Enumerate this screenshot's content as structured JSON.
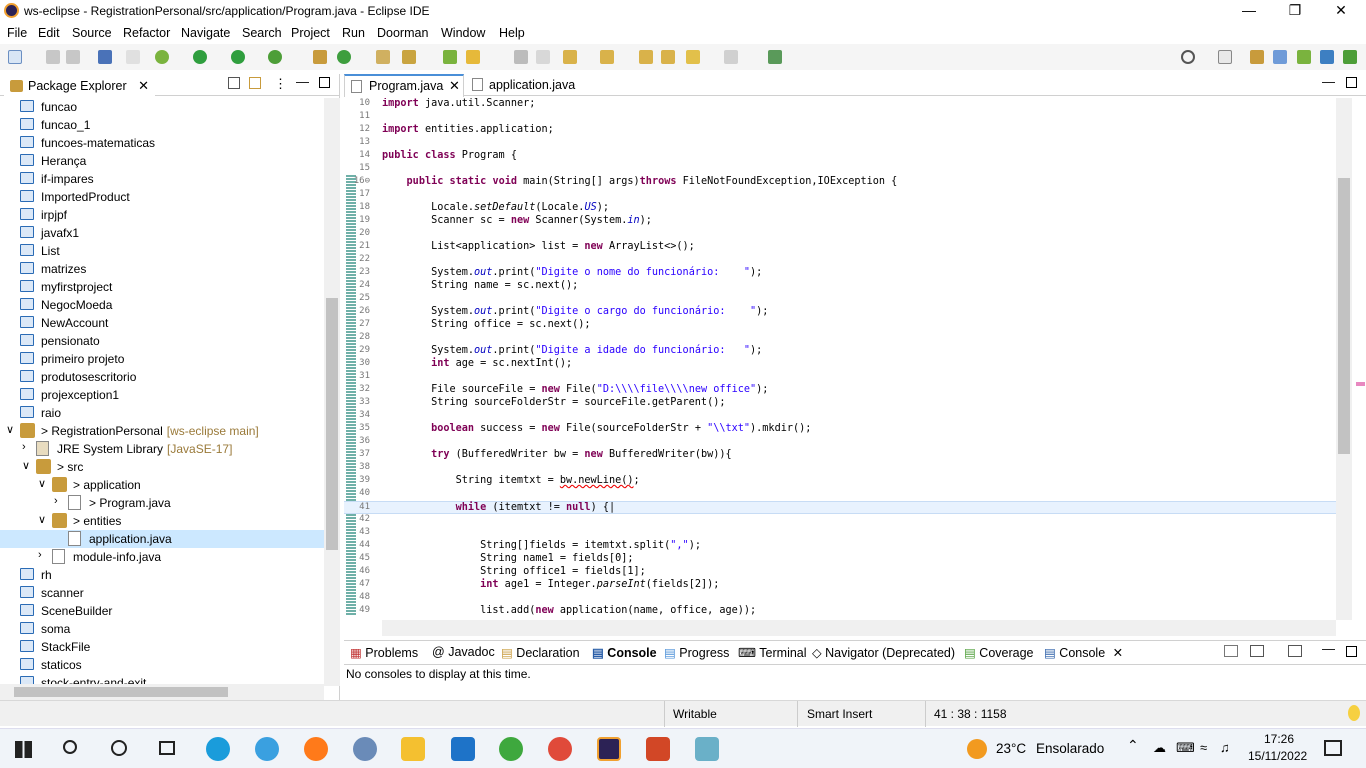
{
  "window": {
    "title": "ws-eclipse - RegistrationPersonal/src/application/Program.java - Eclipse IDE"
  },
  "menu": [
    "File",
    "Edit",
    "Source",
    "Refactor",
    "Navigate",
    "Search",
    "Project",
    "Run",
    "Doorman",
    "Window",
    "Help"
  ],
  "package_explorer": {
    "title": "Package Explorer",
    "items": [
      {
        "label": "funcao",
        "type": "folder",
        "depth": 0
      },
      {
        "label": "funcao_1",
        "type": "folder",
        "depth": 0
      },
      {
        "label": "funcoes-matematicas",
        "type": "folder",
        "depth": 0
      },
      {
        "label": "Herança",
        "type": "folder",
        "depth": 0
      },
      {
        "label": "if-impares",
        "type": "folder",
        "depth": 0
      },
      {
        "label": "ImportedProduct",
        "type": "folder",
        "depth": 0
      },
      {
        "label": "irpjpf",
        "type": "folder",
        "depth": 0
      },
      {
        "label": "javafx1",
        "type": "folder",
        "depth": 0
      },
      {
        "label": "List",
        "type": "folder",
        "depth": 0
      },
      {
        "label": "matrizes",
        "type": "folder",
        "depth": 0
      },
      {
        "label": "myfirstproject",
        "type": "folder",
        "depth": 0
      },
      {
        "label": "NegocMoeda",
        "type": "folder",
        "depth": 0
      },
      {
        "label": "NewAccount",
        "type": "folder",
        "depth": 0
      },
      {
        "label": "pensionato",
        "type": "folder",
        "depth": 0
      },
      {
        "label": "primeiro projeto",
        "type": "folder",
        "depth": 0
      },
      {
        "label": "produtosescritorio",
        "type": "folder",
        "depth": 0
      },
      {
        "label": "projexception1",
        "type": "folder",
        "depth": 0
      },
      {
        "label": "raio",
        "type": "folder",
        "depth": 0
      },
      {
        "label": "> RegistrationPersonal",
        "suffix": "[ws-eclipse main]",
        "type": "project",
        "depth": 0,
        "arrow": "v"
      },
      {
        "label": "JRE System Library",
        "suffix": "[JavaSE-17]",
        "type": "lib",
        "depth": 1,
        "arrow": ">"
      },
      {
        "label": "> src",
        "type": "pkgroot",
        "depth": 1,
        "arrow": "v"
      },
      {
        "label": "> application",
        "type": "pkg",
        "depth": 2,
        "arrow": "v"
      },
      {
        "label": "> Program.java",
        "type": "java",
        "depth": 3,
        "arrow": ">"
      },
      {
        "label": "> entities",
        "type": "pkg",
        "depth": 2,
        "arrow": "v"
      },
      {
        "label": "application.java",
        "type": "java",
        "depth": 3,
        "selected": true
      },
      {
        "label": "module-info.java",
        "type": "java",
        "depth": 2,
        "arrow": ">"
      },
      {
        "label": "rh",
        "type": "folder",
        "depth": 0
      },
      {
        "label": "scanner",
        "type": "folder",
        "depth": 0
      },
      {
        "label": "SceneBuilder",
        "type": "folder",
        "depth": 0
      },
      {
        "label": "soma",
        "type": "folder",
        "depth": 0
      },
      {
        "label": "StackFile",
        "type": "folder",
        "depth": 0
      },
      {
        "label": "staticos",
        "type": "folder",
        "depth": 0
      },
      {
        "label": "stock-entry-and-exit",
        "type": "folder",
        "depth": 0
      }
    ]
  },
  "editor_tabs": [
    {
      "label": "Program.java",
      "active": true
    },
    {
      "label": "application.java",
      "active": false
    }
  ],
  "code_lines": [
    {
      "n": "10",
      "html": "<span class=\"kw\">import</span> java.util.Scanner;"
    },
    {
      "n": "11",
      "html": ""
    },
    {
      "n": "12",
      "html": "<span class=\"kw\">import</span> entities.application;"
    },
    {
      "n": "13",
      "html": ""
    },
    {
      "n": "14",
      "html": "<span class=\"kw\">public</span> <span class=\"kw\">class</span> Program {"
    },
    {
      "n": "15",
      "html": ""
    },
    {
      "n": "16⊖",
      "html": "    <span class=\"kw\">public</span> <span class=\"kw\">static</span> <span class=\"kw\">void</span> main(String[] args)<span class=\"kw\">throws</span> FileNotFoundException,IOException {"
    },
    {
      "n": "17",
      "html": ""
    },
    {
      "n": "18",
      "html": "        Locale.<i>setDefault</i>(Locale.<span class=\"fd\">US</span>);"
    },
    {
      "n": "19",
      "html": "        Scanner sc = <span class=\"kw\">new</span> Scanner(System.<span class=\"fd\">in</span>);"
    },
    {
      "n": "20",
      "html": ""
    },
    {
      "n": "21",
      "html": "        List&lt;application&gt; list = <span class=\"kw\">new</span> ArrayList&lt;&gt;();"
    },
    {
      "n": "22",
      "html": ""
    },
    {
      "n": "23",
      "html": "        System.<span class=\"fd\">out</span>.print(<span class=\"st\">\"Digite o nome do funcionário:    \"</span>);"
    },
    {
      "n": "24",
      "html": "        String name = sc.next();"
    },
    {
      "n": "25",
      "html": ""
    },
    {
      "n": "26",
      "html": "        System.<span class=\"fd\">out</span>.print(<span class=\"st\">\"Digite o cargo do funcionário:    \"</span>);"
    },
    {
      "n": "27",
      "html": "        String office = sc.next();"
    },
    {
      "n": "28",
      "html": ""
    },
    {
      "n": "29",
      "html": "        System.<span class=\"fd\">out</span>.print(<span class=\"st\">\"Digite a idade do funcionário:   \"</span>);"
    },
    {
      "n": "30",
      "html": "        <span class=\"kw\">int</span> age = sc.nextInt();"
    },
    {
      "n": "31",
      "html": ""
    },
    {
      "n": "32",
      "html": "        File sourceFile = <span class=\"kw\">new</span> File(<span class=\"st\">\"D:\\\\\\\\file\\\\\\\\new office\"</span>);"
    },
    {
      "n": "33",
      "html": "        String sourceFolderStr = sourceFile.getParent();"
    },
    {
      "n": "34",
      "html": ""
    },
    {
      "n": "35",
      "html": "        <span class=\"kw\">boolean</span> success = <span class=\"kw\">new</span> File(sourceFolderStr + <span class=\"st\">\"\\\\txt\"</span>).mkdir();"
    },
    {
      "n": "36",
      "html": ""
    },
    {
      "n": "37",
      "html": "        <span class=\"kw\">try</span> (BufferedWriter bw = <span class=\"kw\">new</span> BufferedWriter(bw)){"
    },
    {
      "n": "38",
      "html": ""
    },
    {
      "n": "39",
      "html": "            String itemtxt = <span style=\"text-decoration:underline wavy #e00\">bw.newLine()</span>;"
    },
    {
      "n": "40",
      "html": ""
    },
    {
      "n": "41",
      "html": "            <span class=\"kw\">while</span> (itemtxt != <span class=\"kw\">null</span>) {|"
    },
    {
      "n": "42",
      "html": ""
    },
    {
      "n": "43",
      "html": ""
    },
    {
      "n": "44",
      "html": "                String[]fields = itemtxt.split(<span class=\"st\">\",\"</span>);"
    },
    {
      "n": "45",
      "html": "                String name1 = fields[0];"
    },
    {
      "n": "46",
      "html": "                String office1 = fields[1];"
    },
    {
      "n": "47",
      "html": "                <span class=\"kw\">int</span> age1 = Integer.<i>parseInt</i>(fields[2]);"
    },
    {
      "n": "48",
      "html": ""
    },
    {
      "n": "49",
      "html": "                list.add(<span class=\"kw\">new</span> application(name, office, age));"
    }
  ],
  "bottom_tabs": [
    "Problems",
    "Javadoc",
    "Declaration",
    "Console",
    "Progress",
    "Terminal",
    "Navigator (Deprecated)",
    "Coverage",
    "Console"
  ],
  "console_message": "No consoles to display at this time.",
  "status": {
    "writable": "Writable",
    "insert": "Smart Insert",
    "position": "41 : 38 : 1158"
  },
  "taskbar": {
    "weather_temp": "23°C",
    "weather_desc": "Ensolarado",
    "time": "17:26",
    "date": "15/11/2022"
  }
}
